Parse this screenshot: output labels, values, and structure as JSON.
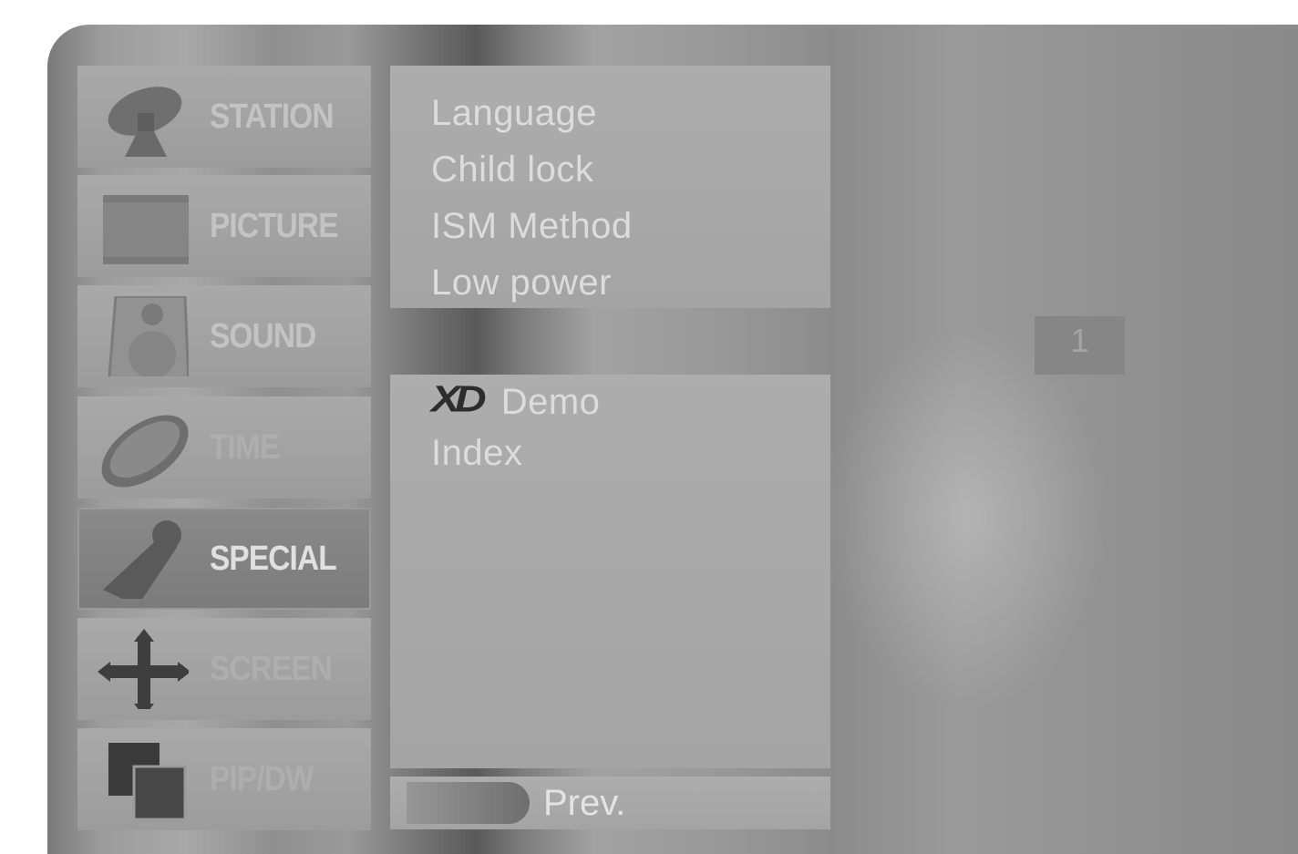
{
  "sidebar": {
    "items": [
      {
        "label": "STATION",
        "icon": "satellite-dish-icon",
        "active": false
      },
      {
        "label": "PICTURE",
        "icon": "picture-frame-icon",
        "active": false
      },
      {
        "label": "SOUND",
        "icon": "speaker-icon",
        "active": false
      },
      {
        "label": "TIME",
        "icon": "clock-disc-icon",
        "active": false
      },
      {
        "label": "SPECIAL",
        "icon": "wrench-icon",
        "active": true
      },
      {
        "label": "SCREEN",
        "icon": "move-arrows-icon",
        "active": false
      },
      {
        "label": "PIP/DW",
        "icon": "pip-windows-icon",
        "active": false
      }
    ]
  },
  "submenu": {
    "top_items": [
      "Language",
      "Child lock",
      "ISM Method",
      "Low power"
    ],
    "xd_logo": "XD",
    "xd_demo": "Demo",
    "index": "Index"
  },
  "footer": {
    "prev_label": "Prev."
  },
  "page_indicator": "1",
  "colors": {
    "panel": "#a8a8a8",
    "active_item": "#7e7e7e",
    "text": "#dcdcdc",
    "xd_logo": "#2d2d2d"
  }
}
